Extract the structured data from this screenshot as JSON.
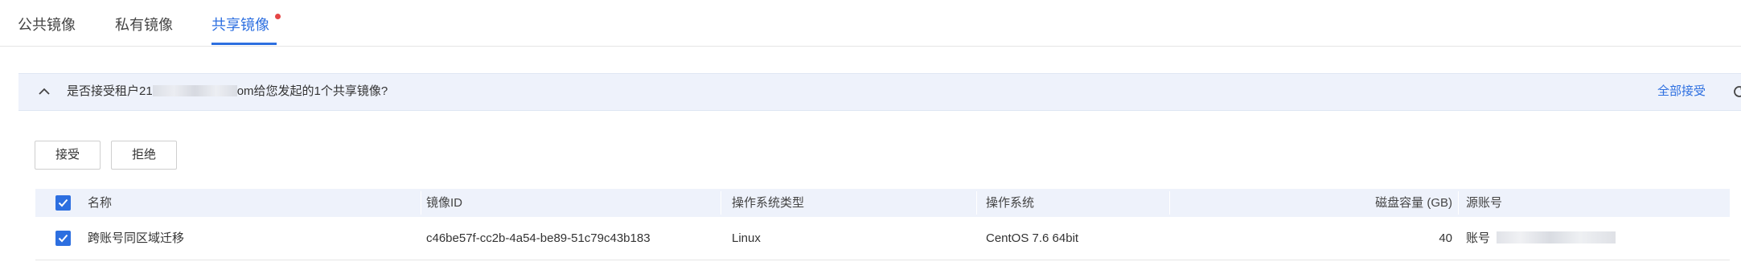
{
  "tabs": [
    {
      "label": "公共镜像",
      "active": false
    },
    {
      "label": "私有镜像",
      "active": false
    },
    {
      "label": "共享镜像",
      "active": true
    }
  ],
  "notice": {
    "prefix": "是否接受租户21",
    "suffix": "om给您发起的1个共享镜像?",
    "accept_all": "全部接受"
  },
  "actions": {
    "accept": "接受",
    "reject": "拒绝"
  },
  "table": {
    "columns": [
      "名称",
      "镜像ID",
      "操作系统类型",
      "操作系统",
      "磁盘容量 (GB)",
      "源账号"
    ],
    "rows": [
      {
        "selected": true,
        "name": "跨账号同区域迁移",
        "image_id": "c46be57f-cc2b-4a54-be89-51c79c43b183",
        "os_type": "Linux",
        "os": "CentOS 7.6 64bit",
        "disk_gb": "40",
        "source_account_label": "账号"
      }
    ]
  },
  "colors": {
    "accent": "#2d6fe0",
    "notice_bg": "#eef2fb",
    "badge_dot": "#e54545"
  },
  "icons": [
    "chevron-up-icon",
    "refresh-icon",
    "checkbox-checked-icon"
  ]
}
